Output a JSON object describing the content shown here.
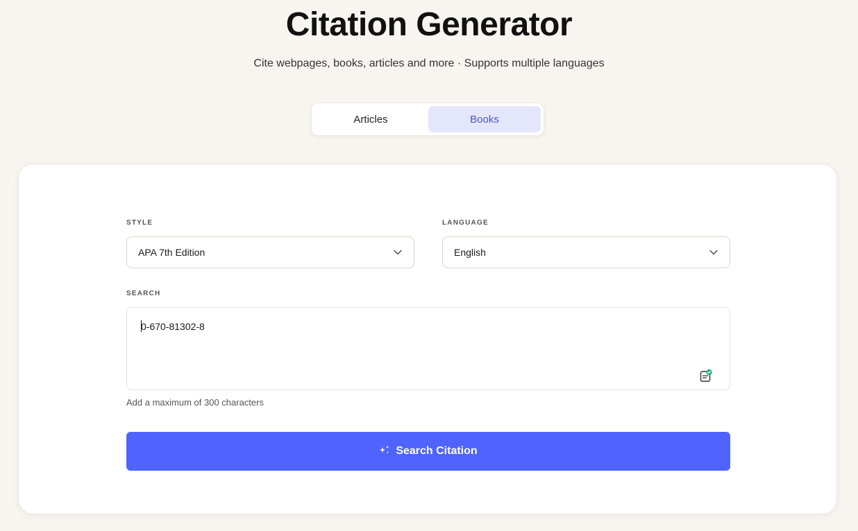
{
  "header": {
    "title": "Citation Generator",
    "subtitle": "Cite webpages, books, articles and more · Supports multiple languages"
  },
  "tabs": [
    {
      "label": "Articles",
      "active": false
    },
    {
      "label": "Books",
      "active": true
    }
  ],
  "form": {
    "style": {
      "label": "STYLE",
      "value": "APA 7th Edition"
    },
    "language": {
      "label": "LANGUAGE",
      "value": "English"
    },
    "search": {
      "label": "SEARCH",
      "value": "0-670-81302-8",
      "hint": "Add a maximum of 300 characters"
    },
    "submit_label": "Search Citation"
  },
  "colors": {
    "background": "#f8f5f0",
    "accent": "#4f63ff",
    "active_tab_bg": "#e4e7fb",
    "active_tab_text": "#4a55c8",
    "check_badge": "#1fb27a"
  },
  "icons": {
    "select_chevron": "chevron-down-icon",
    "paste_check": "clipboard-check-icon",
    "button_sparkle": "sparkle-icon"
  }
}
